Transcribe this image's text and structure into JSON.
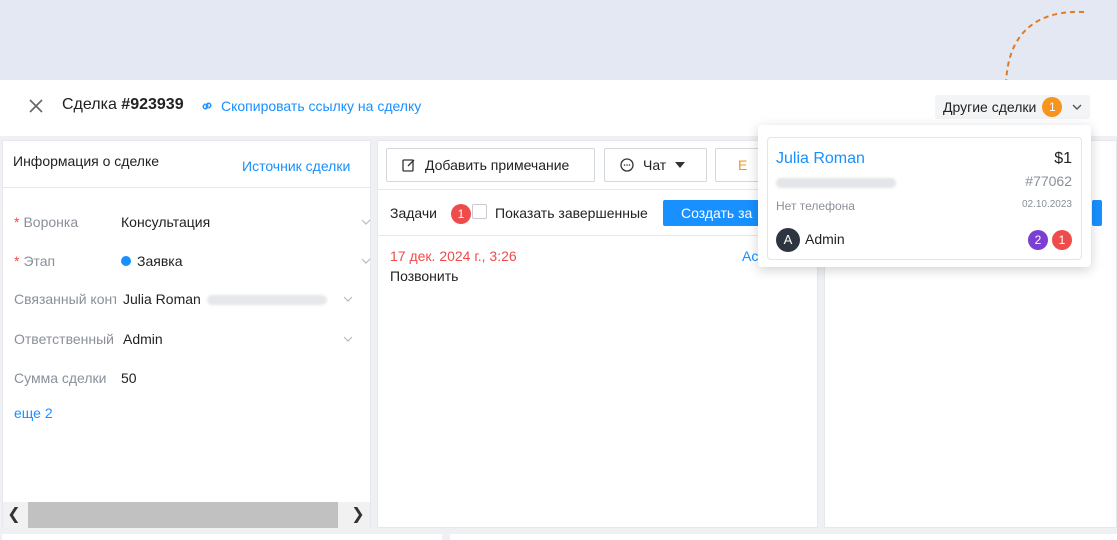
{
  "header": {
    "close_icon": "close-icon",
    "deal_prefix": "Сделка",
    "deal_number": "#923939",
    "copy_link_label": "Скопировать ссылку на сделку",
    "other_deals_label": "Другие сделки",
    "other_deals_count": "1"
  },
  "info_panel": {
    "title": "Информация о сделке",
    "source_link": "Источник сделки",
    "fields": [
      {
        "label": "Воронка",
        "required": true,
        "value": "Консультация",
        "dropdown": true
      },
      {
        "label": "Этап",
        "required": true,
        "value": "Заявка",
        "status_color": "#1890ff",
        "dropdown": true
      },
      {
        "label": "Связанный контакт",
        "required": false,
        "value": "Julia Roman",
        "dropdown": true
      },
      {
        "label": "Ответственный",
        "required": false,
        "value": "Admin",
        "dropdown": true
      },
      {
        "label": "Сумма сделки",
        "required": false,
        "value": "50",
        "dropdown": false
      }
    ],
    "more_link": "еще 2"
  },
  "activity_panel": {
    "add_note_label": "Добавить примечание",
    "chat_label": "Чат",
    "email_label": "Е",
    "tasks_label": "Задачи",
    "tasks_count": "1",
    "show_completed_label": "Показать завершенные",
    "create_task_label": "Создать за",
    "tasks": [
      {
        "date": "17 дек. 2024 г., 3:26",
        "text": "Позвонить",
        "assignee": "Ас"
      }
    ]
  },
  "other_deals_popup": {
    "card": {
      "name": "Julia Roman",
      "amount": "$1",
      "deal_id": "#77062",
      "phone": "Нет телефона",
      "date": "02.10.2023",
      "owner_initial": "A",
      "owner": "Admin",
      "badge_purple": "2",
      "badge_red": "1"
    }
  },
  "colors": {
    "accent": "#1890ff",
    "orange": "#f7941d",
    "red": "#f04b4b",
    "purple": "#7b3fd3"
  }
}
